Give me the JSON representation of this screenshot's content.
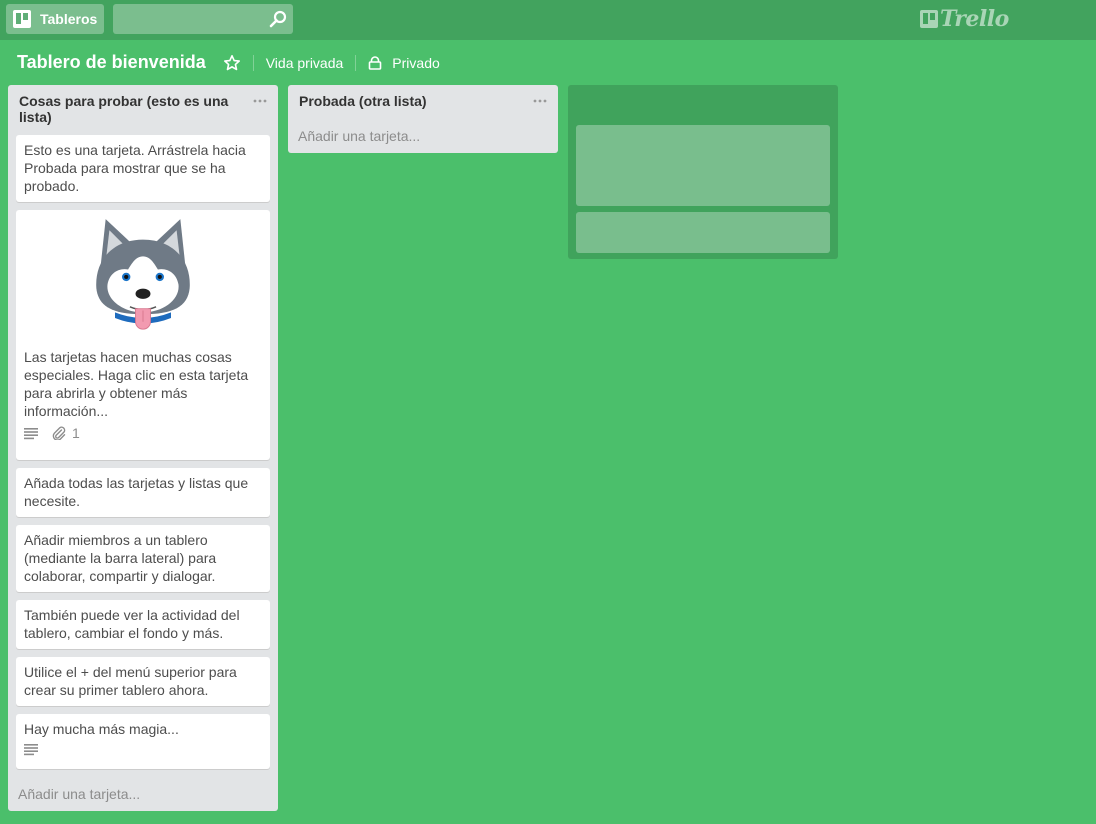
{
  "header": {
    "boards_label": "Tableros",
    "search_value": "",
    "logo_text": "Trello"
  },
  "board": {
    "title": "Tablero de bienvenida",
    "visibility_label": "Vida privada",
    "privacy_label": "Privado"
  },
  "lists": [
    {
      "title": "Cosas para probar (esto es una lista)",
      "add_card_label": "Añadir una tarjeta...",
      "cards": [
        {
          "text": "Esto es una tarjeta. Arrástrela hacia Probada para mostrar que se ha probado."
        },
        {
          "text": "Las tarjetas hacen muchas cosas especiales. Haga clic en esta tarjeta para abrirla y obtener más información...",
          "attachments": "1"
        },
        {
          "text": "Añada todas las tarjetas y listas que necesite."
        },
        {
          "text": "Añadir miembros a un tablero (mediante la barra lateral) para colaborar, compartir y dialogar."
        },
        {
          "text": "También puede ver la actividad del tablero, cambiar el fondo y más."
        },
        {
          "text": "Utilice el + del menú superior para crear su primer tablero ahora."
        },
        {
          "text": "Hay mucha más magia..."
        }
      ]
    },
    {
      "title": "Probada (otra lista)",
      "add_card_label": "Añadir una tarjeta..."
    }
  ],
  "icons": {
    "boards": "boards-icon",
    "search": "search-icon",
    "star": "star-icon",
    "lock": "lock-icon",
    "description": "description-icon",
    "attachment": "paperclip-icon",
    "menu": "ellipsis-icon"
  },
  "colors": {
    "background": "#4bbf6b",
    "header": "#42a35e",
    "list": "#e2e4e6"
  }
}
